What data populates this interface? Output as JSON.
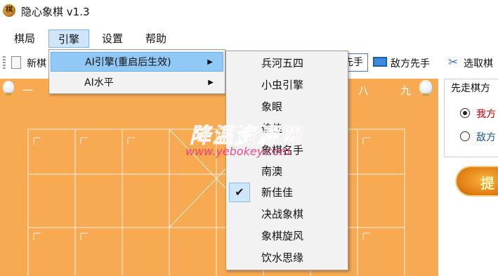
{
  "window": {
    "title": "隐心象棋 v1.3",
    "app_icon_text": "棋"
  },
  "menubar": {
    "items": [
      "棋局",
      "引擎",
      "设置",
      "帮助"
    ]
  },
  "toolbar": {
    "new_label": "新棋",
    "my_first_label": "先手",
    "enemy_first_label": "敌方先手",
    "cancel_label": "选取棋"
  },
  "board": {
    "column_numbers": [
      "一",
      "八",
      "九"
    ],
    "color": "#f8aa52"
  },
  "panel": {
    "title": "先走棋方",
    "options": [
      {
        "label": "我方",
        "checked": true
      },
      {
        "label": "敌方",
        "checked": false
      }
    ],
    "hint_button": "提"
  },
  "dropdown": {
    "items": [
      {
        "label": "AI引擎(重启后生效)",
        "arrow": "▶",
        "highlighted": true
      },
      {
        "label": "AI水平",
        "arrow": "▶",
        "highlighted": false
      }
    ]
  },
  "submenu": {
    "items": [
      "兵河五四",
      "小虫引擎",
      "象眼",
      "佳佳",
      "象棋名手",
      "南澳",
      "新佳佳",
      "决战象棋",
      "象棋旋风",
      "饮水思缘"
    ],
    "checked_item": "新佳佳",
    "check_glyph": "✔"
  },
  "watermark": {
    "text": "降温资源网",
    "url": "www.yebokey.com"
  }
}
